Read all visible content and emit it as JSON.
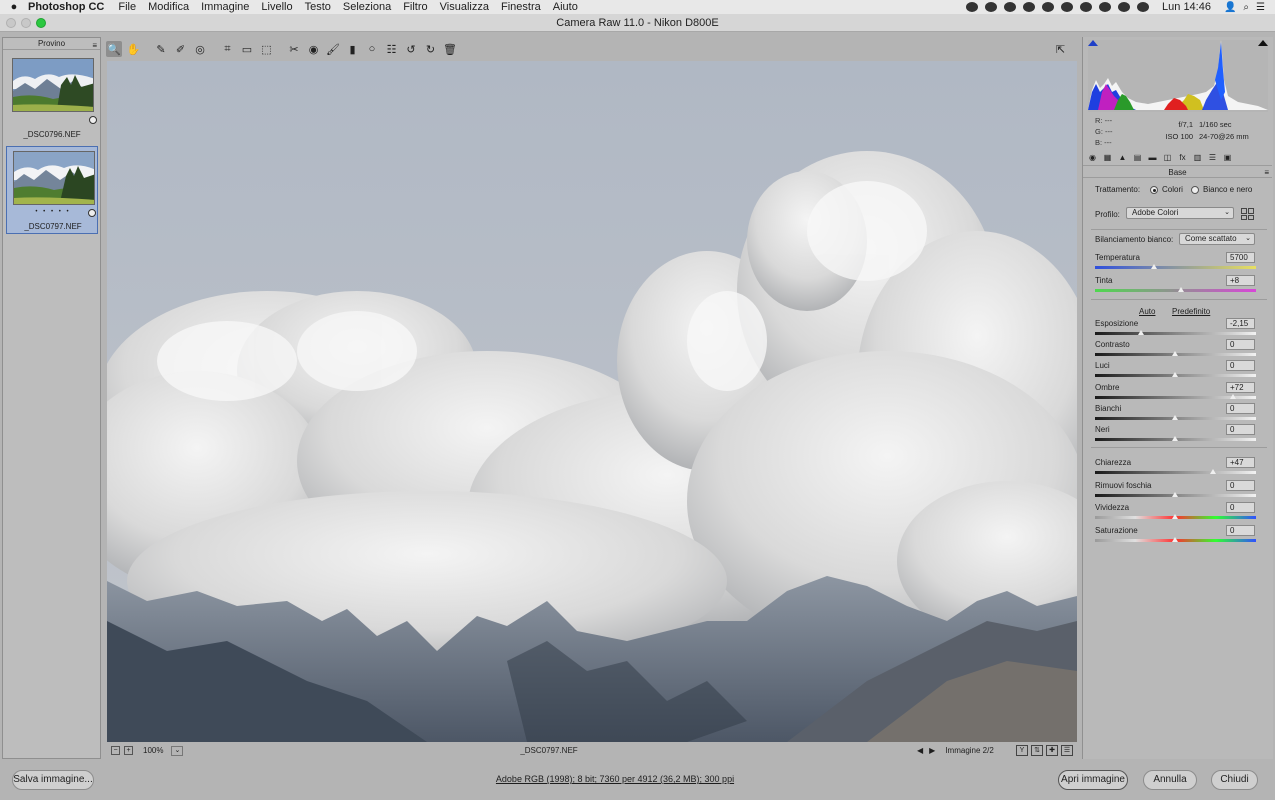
{
  "menubar": {
    "app_name": "Photoshop CC",
    "menus": [
      "File",
      "Modifica",
      "Immagine",
      "Livello",
      "Testo",
      "Seleziona",
      "Filtro",
      "Visualizza",
      "Finestra",
      "Aiuto"
    ],
    "clock": "Lun 14:46"
  },
  "window": {
    "title": "Camera Raw 11.0  -  Nikon D800E"
  },
  "filmstrip": {
    "header": "Provino",
    "items": [
      {
        "filename": "_DSC0796.NEF",
        "selected": false
      },
      {
        "filename": "_DSC0797.NEF",
        "selected": true,
        "stars": "• • • • •"
      }
    ]
  },
  "status": {
    "zoom_out": "−",
    "zoom_in": "+",
    "zoom": "100%",
    "zoom_dropdown": "⌄",
    "filename": "_DSC0797.NEF",
    "counter": "Immagine 2/2",
    "prev": "◀",
    "next": "▶",
    "view_y": "Y"
  },
  "histogram": {
    "r": "R:   ---",
    "g": "G:   ---",
    "b": "B:   ---",
    "aperture": "f/7,1",
    "shutter": "1/160 sec",
    "iso": "ISO 100",
    "lens": "24-70@26 mm"
  },
  "panel": {
    "title": "Base",
    "treatment_label": "Trattamento:",
    "treatment_color": "Colori",
    "treatment_bw": "Bianco e nero",
    "profile_label": "Profilo:",
    "profile_value": "Adobe Colori",
    "wb_label": "Bilanciamento bianco:",
    "wb_value": "Come scattato",
    "auto_link": "Auto",
    "default_link": "Predefinito",
    "sliders": [
      {
        "label": "Temperatura",
        "value": "5700",
        "pos": 0.37
      },
      {
        "label": "Tinta",
        "value": "+8",
        "pos": 0.54
      },
      {
        "label": "Esposizione",
        "value": "-2,15",
        "pos": 0.29
      },
      {
        "label": "Contrasto",
        "value": "0",
        "pos": 0.5
      },
      {
        "label": "Luci",
        "value": "0",
        "pos": 0.5
      },
      {
        "label": "Ombre",
        "value": "+72",
        "pos": 0.86
      },
      {
        "label": "Bianchi",
        "value": "0",
        "pos": 0.5
      },
      {
        "label": "Neri",
        "value": "0",
        "pos": 0.5
      },
      {
        "label": "Chiarezza",
        "value": "+47",
        "pos": 0.735
      },
      {
        "label": "Rimuovi foschia",
        "value": "0",
        "pos": 0.5
      },
      {
        "label": "Vividezza",
        "value": "0",
        "pos": 0.5
      },
      {
        "label": "Saturazione",
        "value": "0",
        "pos": 0.5
      }
    ]
  },
  "bottom": {
    "save_label": "Salva immagine...",
    "info_link": "Adobe RGB (1998); 8 bit; 7360 per 4912 (36,2 MB); 300 ppi",
    "open_label": "Apri immagine",
    "cancel_label": "Annulla",
    "close_label": "Chiudi"
  },
  "colors": {
    "selection": "#a7b9d8",
    "clip_shadow": "#1e3fc8",
    "accent": "#4b6fb2"
  }
}
